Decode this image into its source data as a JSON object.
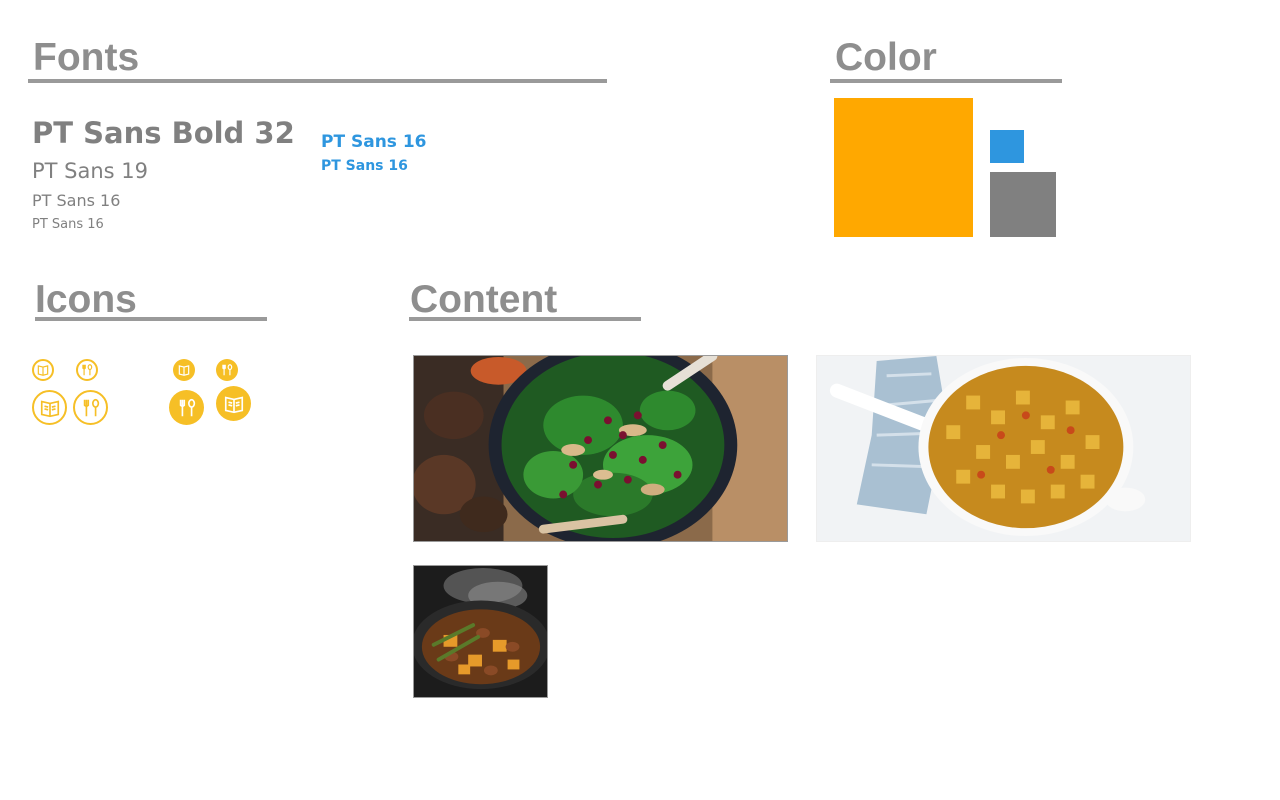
{
  "sections": {
    "fonts": "Fonts",
    "color": "Color",
    "icons": "Icons",
    "content": "Content"
  },
  "fonts": {
    "samples": [
      "PT Sans Bold 32",
      "PT Sans 19",
      "PT Sans 16",
      "PT Sans 16"
    ],
    "blue_samples": [
      "PT Sans 16",
      "PT Sans 16"
    ]
  },
  "colors": {
    "primary": "#ffa800",
    "accent": "#2e96df",
    "neutral": "#808080",
    "icon": "#f6bf26",
    "heading": "#8e8e8e"
  },
  "icons": [
    {
      "name": "recipe-book-icon",
      "style": "outline"
    },
    {
      "name": "fork-spoon-icon",
      "style": "outline"
    },
    {
      "name": "recipe-book-icon",
      "style": "filled"
    },
    {
      "name": "fork-spoon-icon",
      "style": "filled"
    }
  ],
  "content": {
    "images": [
      "salad-photo",
      "potato-curry-photo",
      "stew-photo"
    ]
  }
}
